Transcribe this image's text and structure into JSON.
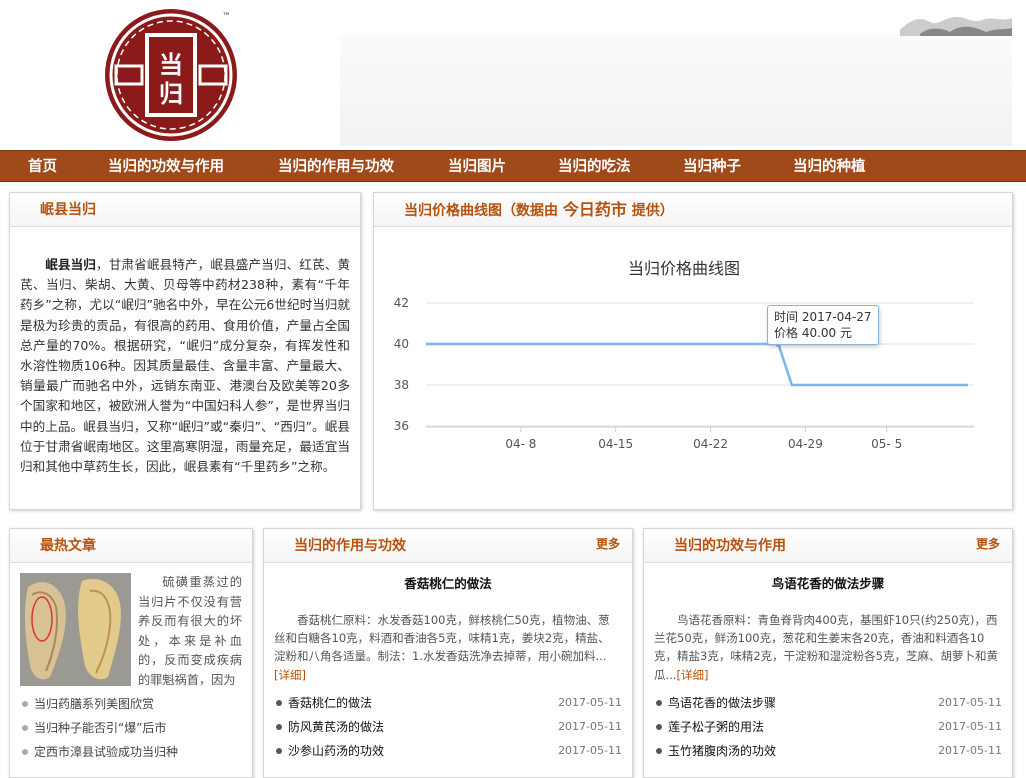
{
  "logo": {
    "glyph_text": "当归",
    "tm": "™"
  },
  "nav": [
    {
      "label": "首页"
    },
    {
      "label": "当归的功效与作用"
    },
    {
      "label": "当归的作用与功效"
    },
    {
      "label": "当归图片"
    },
    {
      "label": "当归的吃法"
    },
    {
      "label": "当归种子"
    },
    {
      "label": "当归的种植"
    }
  ],
  "intro_panel": {
    "title": "岷县当归",
    "lead": "岷县当归",
    "text": "，甘肃省岷县特产，岷县盛产当归、红芪、黄芪、当归、柴胡、大黄、贝母等中药材238种，素有“千年药乡”之称，尤以“岷归”驰名中外，早在公元6世纪时当归就是极为珍贵的贡品，有很高的药用、食用价值，产量占全国总产量的70%。根据研究，“岷归”成分复杂，有挥发性和水溶性物质106种。因其质量最佳、含量丰富、产量最大、销量最广而驰名中外，远销东南亚、港澳台及欧美等20多个国家和地区，被欧洲人誉为“中国妇科人参”，是世界当归中的上品。岷县当归，又称“岷归”或“秦归”、“西归”。岷县位于甘肃省岷南地区。这里高寒阴湿，雨量充足，最适宜当归和其他中草药生长，因此，岷县素有“千里药乡”之称。"
  },
  "price_panel": {
    "title_prefix": "当归价格曲线图（数据由",
    "source": "今日药市",
    "title_suffix": "提供）"
  },
  "chart_data": {
    "type": "line",
    "title": "当归价格曲线图",
    "x": [
      "2017-04-01",
      "2017-04-26",
      "2017-04-27",
      "2017-04-28",
      "2017-05-11"
    ],
    "series": [
      {
        "values": [
          40,
          40,
          40,
          38,
          38
        ]
      }
    ],
    "xticks": [
      "04- 8",
      "04-15",
      "04-22",
      "04-29",
      "05- 5"
    ],
    "yticks": [
      36,
      38,
      40,
      42
    ],
    "ylim": [
      36,
      42
    ],
    "color": "#7cb5ec",
    "tooltip": {
      "date_label": "时间 2017-04-27",
      "price_label": "价格 40.00 元"
    }
  },
  "hot_panel": {
    "title": "最热文章",
    "text": "硫磺重蒸过的当归片不仅没有营养反而有很大的坏处，本来是补血的，反而变成疾病的罪魁祸首，因为",
    "items": [
      {
        "label": "当归药膳系列美图欣赏"
      },
      {
        "label": "当归种子能否引“爆”后市"
      },
      {
        "label": "定西市漳县试验成功当归种"
      }
    ]
  },
  "effect_panel": {
    "title": "当归的作用与功效",
    "more": "更多",
    "article_title": "香菇桃仁的做法",
    "article_body": "香菇桃仁原料：水发香菇100克，鲜核桃仁50克，植物油、葱丝和白糖各10克，料酒和香油各5克，味精1克，姜块2克，精盐、淀粉和八角各适量。制法：1.水发香菇洗净去掉蒂，用小碗加料...",
    "detail_label": "[详细]",
    "items": [
      {
        "label": "香菇桃仁的做法",
        "date": "2017-05-11"
      },
      {
        "label": "防风黄芪汤的做法",
        "date": "2017-05-11"
      },
      {
        "label": "沙参山药汤的功效",
        "date": "2017-05-11"
      }
    ]
  },
  "function_panel": {
    "title": "当归的功效与作用",
    "more": "更多",
    "article_title": "鸟语花香的做法步骤",
    "article_body": "鸟语花香原料：青鱼脊背肉400克，基围虾10只(约250克)，西兰花50克，鲜汤100克，葱花和生姜末各20克，香油和料酒各10克，精盐3克，味精2克，干淀粉和湿淀粉各5克，芝麻、胡萝卜和黄瓜...",
    "detail_label": "[详细]",
    "items": [
      {
        "label": "鸟语花香的做法步骤",
        "date": "2017-05-11"
      },
      {
        "label": "莲子松子粥的用法",
        "date": "2017-05-11"
      },
      {
        "label": "玉竹猪腹肉汤的功效",
        "date": "2017-05-11"
      }
    ]
  },
  "colors": {
    "nav_bg": "#a04a1b",
    "accent": "#b5520f",
    "logo_red": "#8b1a1a",
    "line": "#7cb5ec"
  }
}
